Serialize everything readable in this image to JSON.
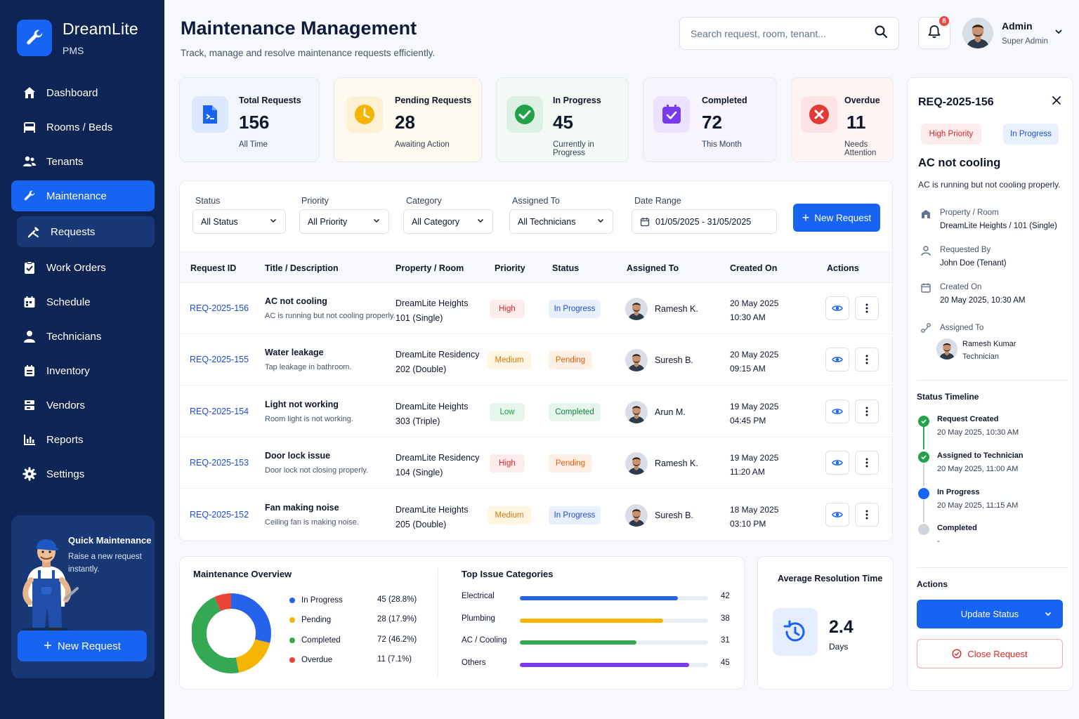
{
  "brand": {
    "name": "DreamLite",
    "sub": "PMS"
  },
  "nav": [
    {
      "label": "Dashboard",
      "icon": "home-icon"
    },
    {
      "label": "Rooms / Beds",
      "icon": "bed-icon"
    },
    {
      "label": "Tenants",
      "icon": "users-icon"
    },
    {
      "label": "Maintenance",
      "icon": "wrench-icon",
      "active": true
    },
    {
      "label": "Requests",
      "icon": "tools-icon",
      "sub": true
    },
    {
      "label": "Work Orders",
      "icon": "clipboard-icon"
    },
    {
      "label": "Schedule",
      "icon": "calendar-icon"
    },
    {
      "label": "Technicians",
      "icon": "person-icon"
    },
    {
      "label": "Inventory",
      "icon": "inventory-icon"
    },
    {
      "label": "Vendors",
      "icon": "vendors-icon"
    },
    {
      "label": "Reports",
      "icon": "bar-chart-icon"
    },
    {
      "label": "Settings",
      "icon": "gear-icon"
    }
  ],
  "quick": {
    "title": "Quick Maintenance",
    "desc": "Raise a new request instantly.",
    "button": "New Request"
  },
  "header": {
    "title": "Maintenance Management",
    "subtitle": "Track, manage and resolve maintenance requests efficiently.",
    "search_placeholder": "Search request, room, tenant...",
    "notifications": "8",
    "user_name": "Admin",
    "user_role": "Super Admin"
  },
  "stats": [
    {
      "label": "Total Requests",
      "value": "156",
      "note": "All Time"
    },
    {
      "label": "Pending Requests",
      "value": "28",
      "note": "Awaiting Action"
    },
    {
      "label": "In Progress",
      "value": "45",
      "note": "Currently in Progress"
    },
    {
      "label": "Completed",
      "value": "72",
      "note": "This Month"
    },
    {
      "label": "Overdue",
      "value": "11",
      "note": "Needs Attention"
    }
  ],
  "filters": {
    "status_label": "Status",
    "status_value": "All Status",
    "priority_label": "Priority",
    "priority_value": "All Priority",
    "category_label": "Category",
    "category_value": "All Category",
    "assigned_label": "Assigned To",
    "assigned_value": "All Technicians",
    "date_label": "Date Range",
    "date_value": "01/05/2025 - 31/05/2025",
    "new_button": "New Request"
  },
  "table": {
    "headers": [
      "Request ID",
      "Title / Description",
      "Property / Room",
      "Priority",
      "Status",
      "Assigned To",
      "Created On",
      "Actions"
    ],
    "rows": [
      {
        "id": "REQ-2025-156",
        "title": "AC not cooling",
        "desc": "AC is running but not cooling properly.",
        "property": "DreamLite Heights",
        "room": "101 (Single)",
        "priority": "High",
        "status": "In Progress",
        "assigned": "Ramesh K.",
        "date": "20 May 2025",
        "time": "10:30 AM"
      },
      {
        "id": "REQ-2025-155",
        "title": "Water leakage",
        "desc": "Tap leakage in bathroom.",
        "property": "DreamLite Residency",
        "room": "202 (Double)",
        "priority": "Medium",
        "status": "Pending",
        "assigned": "Suresh B.",
        "date": "20 May 2025",
        "time": "09:15 AM"
      },
      {
        "id": "REQ-2025-154",
        "title": "Light not working",
        "desc": "Room light is not working.",
        "property": "DreamLite Heights",
        "room": "303 (Triple)",
        "priority": "Low",
        "status": "Completed",
        "assigned": "Arun M.",
        "date": "19 May 2025",
        "time": "04:45 PM"
      },
      {
        "id": "REQ-2025-153",
        "title": "Door lock issue",
        "desc": "Door lock not closing properly.",
        "property": "DreamLite Residency",
        "room": "104 (Single)",
        "priority": "High",
        "status": "Pending",
        "assigned": "Ramesh K.",
        "date": "19 May 2025",
        "time": "11:20 AM"
      },
      {
        "id": "REQ-2025-152",
        "title": "Fan making noise",
        "desc": "Ceiling fan is making noise.",
        "property": "DreamLite Heights",
        "room": "205 (Double)",
        "priority": "Medium",
        "status": "In Progress",
        "assigned": "Suresh B.",
        "date": "18 May 2025",
        "time": "03:10 PM"
      }
    ]
  },
  "overview": {
    "title": "Maintenance Overview",
    "items": [
      {
        "label": "In Progress",
        "value": 45,
        "text": "45 (28.8%)",
        "color": "#2563eb"
      },
      {
        "label": "Pending",
        "value": 28,
        "text": "28 (17.9%)",
        "color": "#f5b400"
      },
      {
        "label": "Completed",
        "value": 72,
        "text": "72 (46.2%)",
        "color": "#34a853"
      },
      {
        "label": "Overdue",
        "value": 11,
        "text": "11 (7.1%)",
        "color": "#ea4335"
      }
    ]
  },
  "categories": {
    "title": "Top Issue Categories",
    "max": 50,
    "items": [
      {
        "label": "Electrical",
        "value": 42,
        "color": "#2563eb"
      },
      {
        "label": "Plumbing",
        "value": 38,
        "color": "#f5b400"
      },
      {
        "label": "AC / Cooling",
        "value": 31,
        "color": "#34a853"
      },
      {
        "label": "Others",
        "value": 45,
        "color": "#7c3aed"
      }
    ]
  },
  "resolution": {
    "title": "Average Resolution Time",
    "value": "2.4",
    "unit": "Days"
  },
  "detail": {
    "id": "REQ-2025-156",
    "priority": "High Priority",
    "status": "In Progress",
    "title": "AC not cooling",
    "desc": "AC is running but not cooling properly.",
    "property_label": "Property / Room",
    "property_value": "DreamLite Heights / 101 (Single)",
    "requested_label": "Requested By",
    "requested_value": "John Doe (Tenant)",
    "created_label": "Created On",
    "created_value": "20 May 2025, 10:30 AM",
    "assigned_label": "Assigned To",
    "assigned_name": "Ramesh Kumar",
    "assigned_role": "Technician",
    "timeline_title": "Status Timeline",
    "timeline": [
      {
        "title": "Request Created",
        "time": "20 May 2025, 10:30 AM"
      },
      {
        "title": "Assigned to Technician",
        "time": "20 May 2025, 11:00 AM"
      },
      {
        "title": "In Progress",
        "time": "20 May 2025, 11:15 AM"
      },
      {
        "title": "Completed",
        "time": "-"
      }
    ],
    "actions_title": "Actions",
    "update_button": "Update Status",
    "close_button": "Close Request"
  },
  "colors": {
    "primary": "#1763f2",
    "sidebar": "#0e2455",
    "high": "#ef4444",
    "medium": "#d97706",
    "low": "#16a34a",
    "pending": "#ea580c",
    "progress": "#2563eb"
  }
}
